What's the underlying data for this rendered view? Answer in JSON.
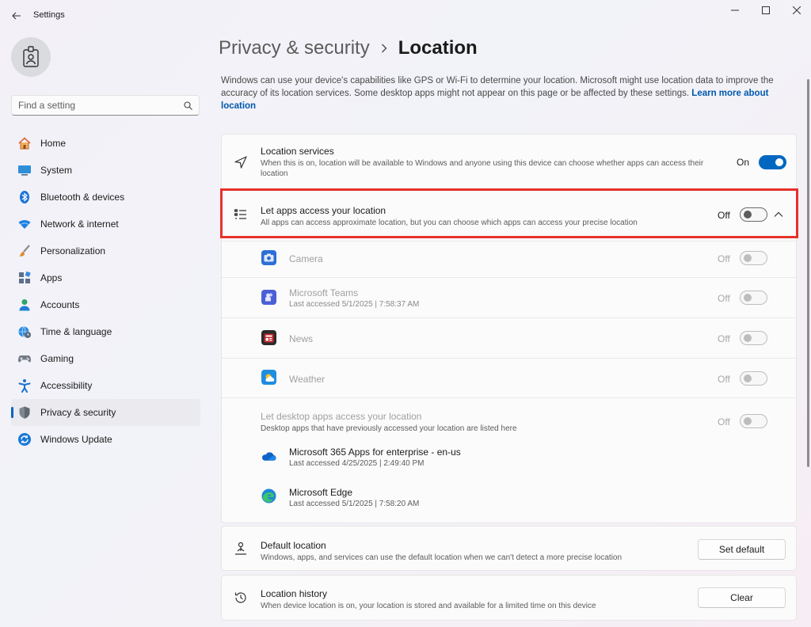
{
  "window": {
    "title": "Settings"
  },
  "search": {
    "placeholder": "Find a setting"
  },
  "sidebar": {
    "items": [
      {
        "label": "Home",
        "icon": "home-icon"
      },
      {
        "label": "System",
        "icon": "monitor-icon"
      },
      {
        "label": "Bluetooth & devices",
        "icon": "bluetooth-icon"
      },
      {
        "label": "Network & internet",
        "icon": "wifi-icon"
      },
      {
        "label": "Personalization",
        "icon": "brush-icon"
      },
      {
        "label": "Apps",
        "icon": "apps-icon"
      },
      {
        "label": "Accounts",
        "icon": "person-icon"
      },
      {
        "label": "Time & language",
        "icon": "globe-clock-icon"
      },
      {
        "label": "Gaming",
        "icon": "gamepad-icon"
      },
      {
        "label": "Accessibility",
        "icon": "accessibility-icon"
      },
      {
        "label": "Privacy & security",
        "icon": "shield-icon",
        "active": true
      },
      {
        "label": "Windows Update",
        "icon": "update-icon"
      }
    ]
  },
  "breadcrumb": {
    "parent": "Privacy & security",
    "current": "Location"
  },
  "intro": {
    "text": "Windows can use your device's capabilities like GPS or Wi-Fi to determine your location. Microsoft might use location data to improve the accuracy of its location services. Some desktop apps might not appear on this page or be affected by these settings. ",
    "link": "Learn more about location"
  },
  "location_services": {
    "title": "Location services",
    "desc": "When this is on, location will be available to Windows and anyone using this device can choose whether apps can access their location",
    "state": "On"
  },
  "let_apps": {
    "title": "Let apps access your location",
    "desc": "All apps can access approximate location, but you can choose which apps can access your precise location",
    "state": "Off"
  },
  "apps": [
    {
      "name": "Camera",
      "meta": "",
      "state": "Off",
      "icon": "camera-icon",
      "color": "#2b6fd6"
    },
    {
      "name": "Microsoft Teams",
      "meta": "Last accessed 5/1/2025  |  7:58:37 AM",
      "state": "Off",
      "icon": "teams-icon",
      "color": "#4b5fd6"
    },
    {
      "name": "News",
      "meta": "",
      "state": "Off",
      "icon": "news-icon",
      "color": "#c4262e"
    },
    {
      "name": "Weather",
      "meta": "",
      "state": "Off",
      "icon": "weather-icon",
      "color": "#1f8de0"
    }
  ],
  "desktop_apps": {
    "title": "Let desktop apps access your location",
    "desc": "Desktop apps that have previously accessed your location are listed here",
    "state": "Off",
    "items": [
      {
        "name": "Microsoft 365 Apps for enterprise - en-us",
        "meta": "Last accessed 4/25/2025  |  2:49:40 PM",
        "icon": "onedrive-cloud-icon"
      },
      {
        "name": "Microsoft Edge",
        "meta": "Last accessed 5/1/2025  |  7:58:20 AM",
        "icon": "edge-icon"
      }
    ]
  },
  "default_location": {
    "title": "Default location",
    "desc": "Windows, apps, and services can use the default location when we can't detect a more precise location",
    "button": "Set default"
  },
  "location_history": {
    "title": "Location history",
    "desc": "When device location is on, your location is stored and available for a limited time on this device",
    "button": "Clear"
  },
  "colors": {
    "accent": "#0067c0",
    "highlight": "#e5322c"
  }
}
